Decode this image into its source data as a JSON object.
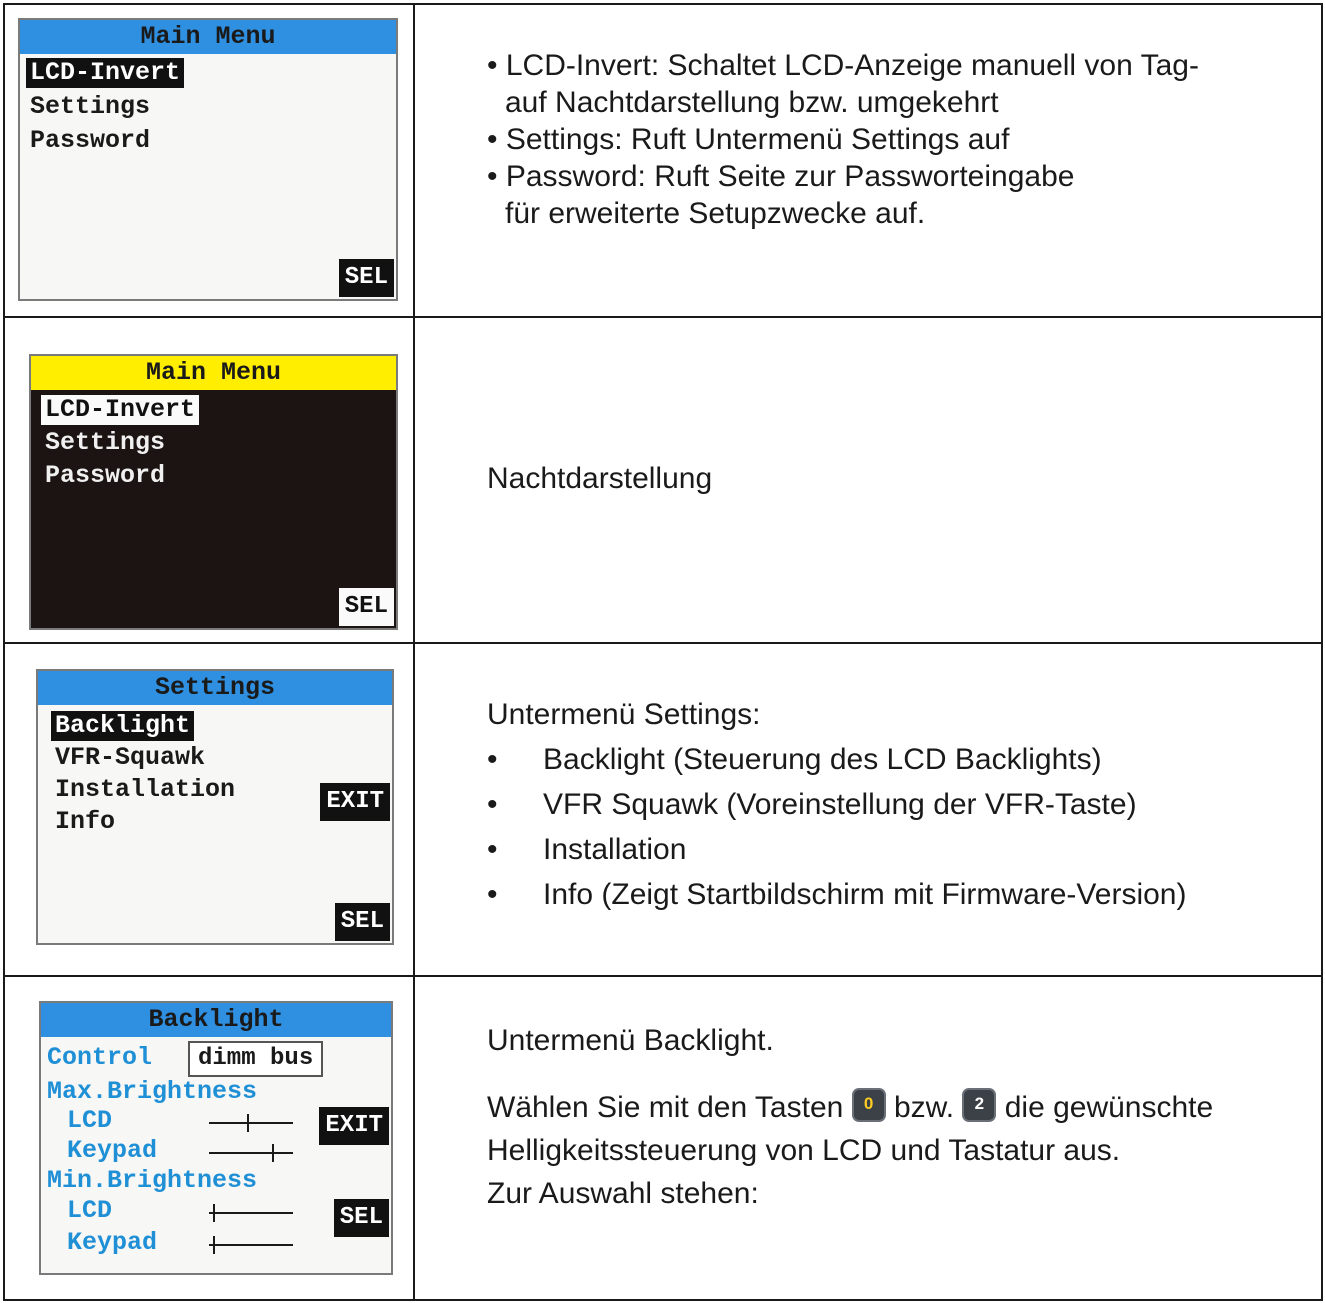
{
  "rows": [
    {
      "screen": {
        "title": "Main Menu",
        "items": [
          "LCD-Invert",
          "Settings",
          "Password"
        ],
        "sel": "SEL"
      },
      "text": {
        "bullets": [
          [
            "• LCD-Invert: Schaltet LCD-Anzeige manuell von Tag-",
            "auf Nachtdarstellung bzw. umgekehrt"
          ],
          [
            "• Settings: Ruft Untermenü Settings auf"
          ],
          [
            "• Password: Ruft Seite zur Passworteingabe",
            "für erweiterte Setupzwecke auf."
          ]
        ]
      }
    },
    {
      "screen": {
        "title": "Main Menu",
        "items": [
          "LCD-Invert",
          "Settings",
          "Password"
        ],
        "sel": "SEL"
      },
      "text": {
        "caption": "Nachtdarstellung"
      }
    },
    {
      "screen": {
        "title": "Settings",
        "items": [
          "Backlight",
          "VFR-Squawk",
          "Installation",
          "Info"
        ],
        "exit": "EXIT",
        "sel": "SEL"
      },
      "text": {
        "heading": "Untermenü Settings:",
        "bullets": [
          "Backlight (Steuerung des LCD Backlights)",
          "VFR Squawk (Voreinstellung der VFR-Taste)",
          "Installation",
          "Info (Zeigt Startbildschirm mit Firmware-Version)"
        ]
      }
    },
    {
      "screen": {
        "title": "Backlight",
        "control_label": "Control",
        "control_value": "dimm bus",
        "max_label": "Max.Brightness",
        "min_label": "Min.Brightness",
        "lcd_label": "LCD",
        "keypad_label": "Keypad",
        "max_lcd_level": 0.45,
        "max_keypad_level": 0.75,
        "min_lcd_level": 0.05,
        "min_keypad_level": 0.05,
        "exit": "EXIT",
        "sel": "SEL"
      },
      "text": {
        "heading": "Untermenü Backlight.",
        "line1_a": "Wählen Sie mit den Tasten",
        "key1": "0",
        "line1_b": "bzw.",
        "key2": "2",
        "line1_c": "die gewünschte",
        "line2": "Helligkeitssteuerung von LCD und Tastatur aus.",
        "line3": "Zur Auswahl stehen:"
      }
    }
  ]
}
